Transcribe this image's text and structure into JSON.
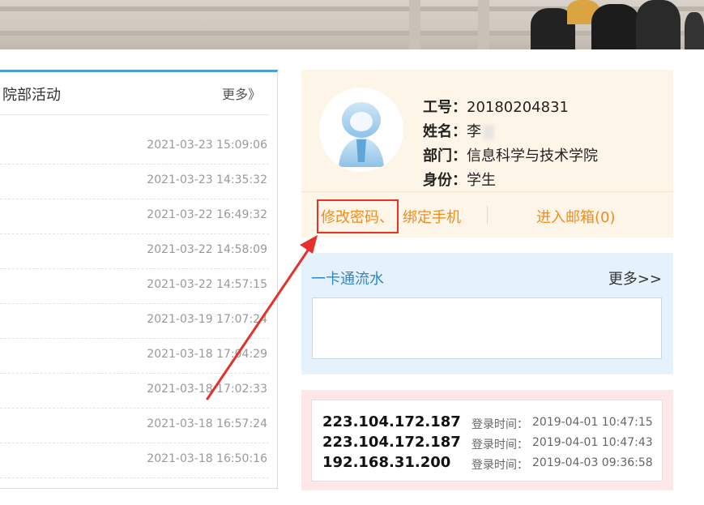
{
  "news": {
    "title": "院部活动",
    "more": "更多》",
    "items": [
      {
        "time": "2021-03-23 15:09:06"
      },
      {
        "time": "2021-03-23 14:35:32"
      },
      {
        "time": "2021-03-22 16:49:32"
      },
      {
        "time": "2021-03-22 14:58:09"
      },
      {
        "time": "2021-03-22 14:57:15"
      },
      {
        "time": "2021-03-19 17:07:24"
      },
      {
        "time": "2021-03-18 17:04:29"
      },
      {
        "time": "2021-03-18 17:02:33"
      },
      {
        "time": "2021-03-18 16:57:24"
      },
      {
        "time": "2021-03-18 16:50:16"
      }
    ]
  },
  "user": {
    "id_label": "工号：",
    "id_value": "20180204831",
    "name_label": "姓名：",
    "name_value": "李",
    "dept_label": "部门：",
    "dept_value": "信息科学与技术学院",
    "role_label": "身份：",
    "role_value": "学生",
    "change_password": "修改密码、",
    "bind_phone": "绑定手机",
    "mailbox": "进入邮箱(0)"
  },
  "card_flow": {
    "title": "一卡通流水",
    "more": "更多>>"
  },
  "logins": [
    {
      "ip": "223.104.172.187",
      "label": "登录时间：",
      "time": "2019-04-01 10:47:15"
    },
    {
      "ip": "223.104.172.187",
      "label": "登录时间：",
      "time": "2019-04-01 10:47:43"
    },
    {
      "ip": "192.168.31.200",
      "label": "登录时间：",
      "time": "2019-04-03 09:36:58"
    }
  ],
  "colors": {
    "accent_blue": "#2f86c8",
    "link_orange": "#f08c1a",
    "annotation_red": "#e8302b"
  }
}
